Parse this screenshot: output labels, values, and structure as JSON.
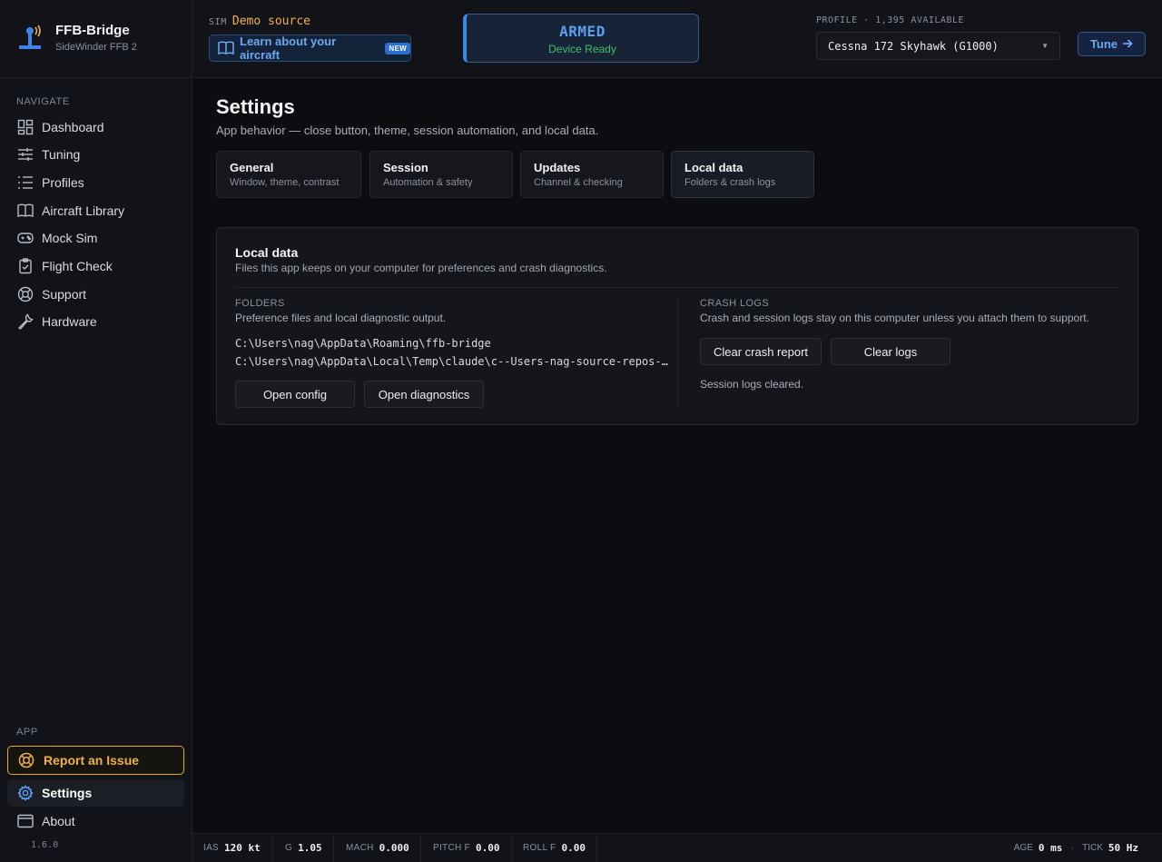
{
  "brand": {
    "title": "FFB-Bridge",
    "subtitle": "SideWinder FFB 2"
  },
  "sidebar": {
    "navigate_label": "NAVIGATE",
    "items": [
      {
        "label": "Dashboard",
        "icon": "dashboard-icon"
      },
      {
        "label": "Tuning",
        "icon": "sliders-icon"
      },
      {
        "label": "Profiles",
        "icon": "list-icon"
      },
      {
        "label": "Aircraft Library",
        "icon": "book-icon"
      },
      {
        "label": "Mock Sim",
        "icon": "gamepad-icon"
      },
      {
        "label": "Flight Check",
        "icon": "clipboard-check-icon"
      },
      {
        "label": "Support",
        "icon": "lifebuoy-icon"
      },
      {
        "label": "Hardware",
        "icon": "wrench-icon"
      }
    ],
    "app_label": "APP",
    "report_label": "Report an Issue",
    "settings_label": "Settings",
    "about_label": "About",
    "version": "1.6.0"
  },
  "topbar": {
    "sim_tag": "SIM",
    "sim_value": "Demo source",
    "learn_label": "Learn about your aircraft",
    "new_badge": "NEW",
    "armed_title": "ARMED",
    "armed_sub": "Device Ready",
    "profile_label": "PROFILE · 1,395 AVAILABLE",
    "profile_value": "Cessna 172 Skyhawk (G1000)",
    "tune_label": "Tune"
  },
  "page": {
    "title": "Settings",
    "subtitle": "App behavior — close button, theme, session automation, and local data.",
    "tabs": [
      {
        "title": "General",
        "sub": "Window, theme, contrast"
      },
      {
        "title": "Session",
        "sub": "Automation & safety"
      },
      {
        "title": "Updates",
        "sub": "Channel & checking"
      },
      {
        "title": "Local data",
        "sub": "Folders & crash logs"
      }
    ],
    "active_tab": "Local data"
  },
  "card": {
    "title": "Local data",
    "subtitle": "Files this app keeps on your computer for preferences and crash diagnostics.",
    "folders": {
      "label": "FOLDERS",
      "desc": "Preference files and local diagnostic output.",
      "paths": [
        "C:\\Users\\nag\\AppData\\Roaming\\ffb-bridge",
        "C:\\Users\\nag\\AppData\\Local\\Temp\\claude\\c--Users-nag-source-repos-…"
      ],
      "open_config": "Open config",
      "open_diagnostics": "Open diagnostics"
    },
    "crash": {
      "label": "CRASH LOGS",
      "desc": "Crash and session logs stay on this computer unless you attach them to support.",
      "clear_report": "Clear crash report",
      "clear_logs": "Clear logs",
      "status": "Session logs cleared."
    }
  },
  "statusbar": {
    "ias_k": "IAS",
    "ias_v": "120 kt",
    "g_k": "G",
    "g_v": "1.05",
    "mach_k": "MACH",
    "mach_v": "0.000",
    "pitch_k": "PITCH F",
    "pitch_v": "0.00",
    "roll_k": "ROLL F",
    "roll_v": "0.00",
    "age_k": "AGE",
    "age_v": "0 ms",
    "tick_k": "TICK",
    "tick_v": "50 Hz"
  },
  "colors": {
    "accent": "#3d86e6",
    "warning": "#f0b04a",
    "ready": "#3fbf6a"
  }
}
